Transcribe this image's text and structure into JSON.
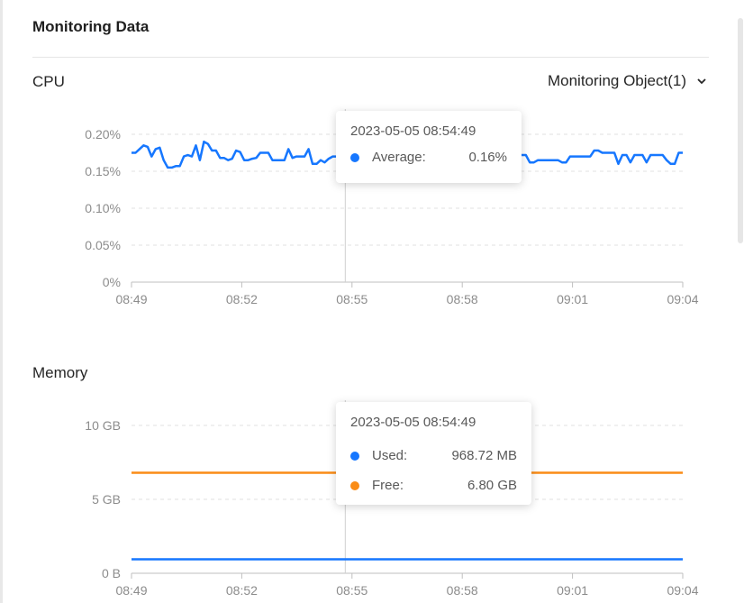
{
  "header": {
    "title": "Monitoring Data"
  },
  "controls": {
    "monitoring_object": "Monitoring Object(1)",
    "dropdown_icon": "chevron-down-icon"
  },
  "colors": {
    "cpu_line": "#1677ff",
    "used": "#1677ff",
    "free": "#fa8c16",
    "grid": "#e0e0e0",
    "axis": "#bfbfbf"
  },
  "chart_data": [
    {
      "type": "line",
      "title": "CPU",
      "categories": [
        "08:49",
        "08:52",
        "08:55",
        "08:58",
        "09:01",
        "09:04"
      ],
      "y_ticks": [
        "0%",
        "0.05%",
        "0.10%",
        "0.15%",
        "0.20%"
      ],
      "ylim": [
        0,
        0.2
      ],
      "xlim": [
        "08:49",
        "09:04"
      ],
      "grid": true,
      "series": [
        {
          "name": "Average",
          "unit": "%",
          "values": [
            0.175,
            0.175,
            0.18,
            0.185,
            0.183,
            0.17,
            0.18,
            0.182,
            0.165,
            0.155,
            0.155,
            0.157,
            0.157,
            0.17,
            0.172,
            0.17,
            0.185,
            0.165,
            0.19,
            0.187,
            0.178,
            0.178,
            0.168,
            0.168,
            0.165,
            0.167,
            0.178,
            0.176,
            0.165,
            0.165,
            0.167,
            0.168,
            0.175,
            0.175,
            0.175,
            0.165,
            0.165,
            0.165,
            0.165,
            0.18,
            0.168,
            0.17,
            0.17,
            0.17,
            0.18,
            0.16,
            0.16,
            0.165,
            0.162,
            0.167,
            0.17,
            0.17,
            0.165,
            0.165,
            0.165,
            0.167,
            0.165,
            0.165,
            0.165,
            0.165,
            0.165,
            0.165,
            0.165,
            0.165,
            0.165,
            0.165,
            0.165,
            0.165,
            0.165,
            0.165,
            0.165,
            0.165,
            0.165,
            0.165,
            0.165,
            0.165,
            0.165,
            0.165,
            0.165,
            0.165,
            0.165,
            0.165,
            0.165,
            0.165,
            0.165,
            0.165,
            0.165,
            0.165,
            0.168,
            0.17,
            0.17,
            0.168,
            0.168,
            0.168,
            0.168,
            0.17,
            0.172,
            0.172,
            0.172,
            0.162,
            0.162,
            0.165,
            0.165,
            0.165,
            0.165,
            0.165,
            0.165,
            0.162,
            0.162,
            0.17,
            0.17,
            0.17,
            0.17,
            0.17,
            0.17,
            0.178,
            0.178,
            0.175,
            0.175,
            0.175,
            0.175,
            0.16,
            0.172,
            0.172,
            0.162,
            0.172,
            0.172,
            0.172,
            0.162,
            0.172,
            0.172,
            0.172,
            0.172,
            0.165,
            0.16,
            0.16,
            0.175,
            0.175
          ]
        }
      ],
      "tooltip": {
        "time": "2023-05-05 08:54:49",
        "rows": [
          {
            "name": "Average:",
            "value": "0.16%",
            "color": "#1677ff"
          }
        ]
      }
    },
    {
      "type": "line",
      "title": "Memory",
      "categories": [
        "08:49",
        "08:52",
        "08:55",
        "08:58",
        "09:01",
        "09:04"
      ],
      "y_ticks": [
        "0 B",
        "5 GB",
        "10 GB"
      ],
      "ylim": [
        0,
        10
      ],
      "grid": true,
      "series": [
        {
          "name": "Used",
          "unit": "GB",
          "values": [
            0.946,
            0.946
          ]
        },
        {
          "name": "Free",
          "unit": "GB",
          "values": [
            6.8,
            6.8
          ]
        }
      ],
      "tooltip": {
        "time": "2023-05-05 08:54:49",
        "rows": [
          {
            "name": "Used:",
            "value": "968.72 MB",
            "color": "#1677ff"
          },
          {
            "name": "Free:",
            "value": "6.80 GB",
            "color": "#fa8c16"
          }
        ]
      }
    }
  ]
}
